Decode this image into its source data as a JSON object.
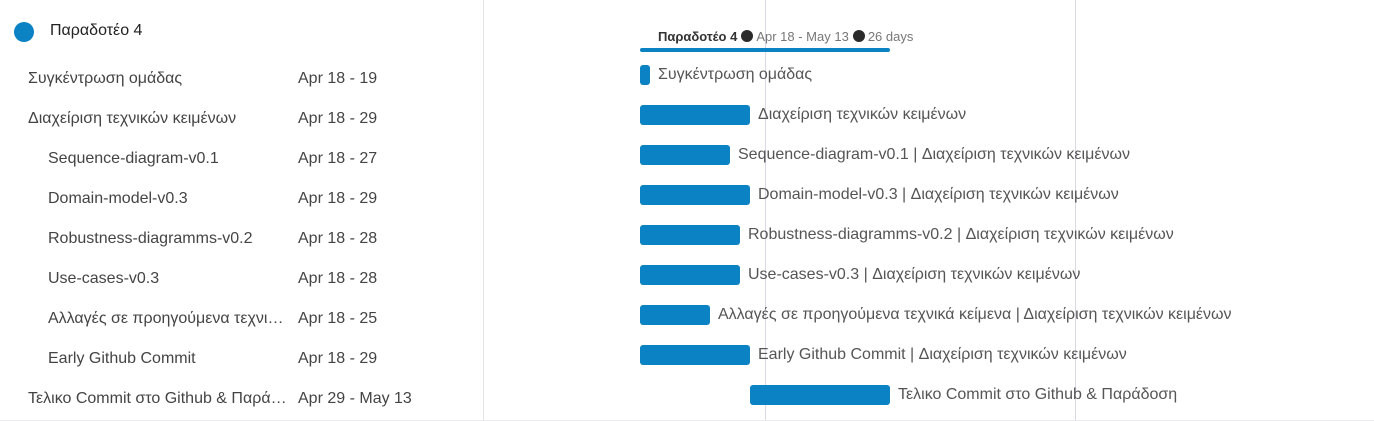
{
  "colors": {
    "accent": "#0b82c4",
    "grid_line": "#d9d9e6"
  },
  "group": {
    "name": "Παραδοτέο 4",
    "summary": {
      "name": "Παραδοτέο 4",
      "range": "Apr 18 - May 13",
      "duration": "26 days"
    }
  },
  "tasks": [
    {
      "name": "Συγκέντρωση ομάδας",
      "dates": "Apr 18 - 19",
      "level": 1,
      "bar_label": "Συγκέντρωση ομάδας",
      "start": "Apr 18",
      "end": "Apr 19"
    },
    {
      "name": "Διαχείριση τεχνικών κειμένων",
      "dates": "Apr 18 - 29",
      "level": 1,
      "bar_label": "Διαχείριση τεχνικών κειμένων",
      "start": "Apr 18",
      "end": "Apr 29"
    },
    {
      "name": "Sequence-diagram-v0.1",
      "dates": "Apr 18 - 27",
      "level": 2,
      "bar_label": "Sequence-diagram-v0.1 | Διαχείριση τεχνικών κειμένων",
      "start": "Apr 18",
      "end": "Apr 27"
    },
    {
      "name": "Domain-model-v0.3",
      "dates": "Apr 18 - 29",
      "level": 2,
      "bar_label": "Domain-model-v0.3 | Διαχείριση τεχνικών κειμένων",
      "start": "Apr 18",
      "end": "Apr 29"
    },
    {
      "name": "Robustness-diagramms-v0.2",
      "dates": "Apr 18 - 28",
      "level": 2,
      "bar_label": "Robustness-diagramms-v0.2 | Διαχείριση τεχνικών κειμένων",
      "start": "Apr 18",
      "end": "Apr 28"
    },
    {
      "name": "Use-cases-v0.3",
      "dates": "Apr 18 - 28",
      "level": 2,
      "bar_label": "Use-cases-v0.3 | Διαχείριση τεχνικών κειμένων",
      "start": "Apr 18",
      "end": "Apr 28"
    },
    {
      "name": "Αλλαγές σε προηγούμενα τεχνικά κείμενα",
      "dates": "Apr 18 - 25",
      "level": 2,
      "bar_label": "Αλλαγές σε προηγούμενα τεχνικά κείμενα | Διαχείριση τεχνικών κειμένων",
      "start": "Apr 18",
      "end": "Apr 25"
    },
    {
      "name": "Early Github Commit",
      "dates": "Apr 18 - 29",
      "level": 2,
      "bar_label": "Early Github Commit | Διαχείριση τεχνικών κειμένων",
      "start": "Apr 18",
      "end": "Apr 29"
    },
    {
      "name": "Τελικο Commit στο Github & Παράδοση",
      "dates": "Apr 29 - May 13",
      "level": 1,
      "bar_label": "Τελικο Commit στο Github & Παράδοση",
      "start": "Apr 29",
      "end": "May 13"
    }
  ]
}
